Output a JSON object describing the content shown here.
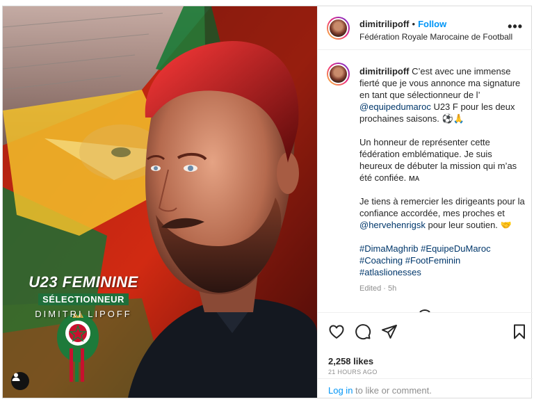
{
  "poster": {
    "line1": "U23 FEMININE",
    "line2": "SÉLECTIONNEUR",
    "line3": "DIMITRI LIPOFF"
  },
  "header": {
    "username": "dimitrilipoff",
    "dot": "•",
    "follow_label": "Follow",
    "subtitle": "Fédération Royale Marocaine de Football",
    "more_icon": "more-horizontal-icon"
  },
  "caption": {
    "username": "dimitrilipoff",
    "p1_text": " C’est avec une immense fierté que je vous annonce ma signature en tant que sélectionneur de l’ ",
    "p1_mention": "@equipedumaroc",
    "p1_end": " U23 F pour les deux prochaines saisons. ⚽🙏",
    "p2": "Un honneur de représenter cette fédération emblématique. Je suis heureux de débuter la mission qui m’as été confiée. ᴍᴀ",
    "p3_text": "Je tiens à remercier les dirigeants pour la confiance accordée, mes proches et ",
    "p3_mention": "@hervehenrigsk",
    "p3_end": " pour leur soutien. 🤝",
    "hashtags": [
      "#DimaMaghrib",
      "#EquipeDuMaroc",
      "#Coaching",
      "#FootFeminin",
      "#atlaslionesses"
    ],
    "edited": "Edited · 5h"
  },
  "actions": {
    "likes": "2,258 likes",
    "timestamp": "21 HOURS AGO",
    "login_link": "Log in",
    "login_rest": " to like or comment."
  },
  "colors": {
    "accent": "#0095f6",
    "link": "#00376b",
    "muted": "#8e8e8e",
    "border": "#dbdbdb"
  }
}
